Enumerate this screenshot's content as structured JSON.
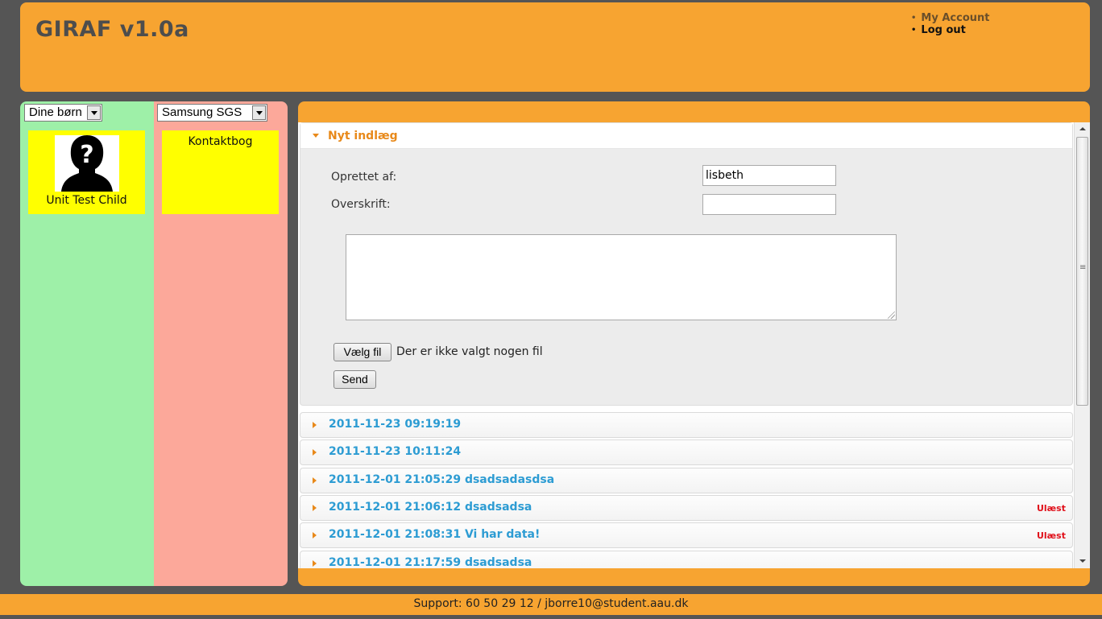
{
  "header": {
    "title": "GIRAF v1.0a",
    "menu": {
      "my_account": "My Account",
      "log_out": "Log out"
    }
  },
  "left": {
    "children_select": "Dine børn",
    "child": {
      "name": "Unit Test Child",
      "avatar_icon": "unknown-person-icon"
    }
  },
  "middle": {
    "device_select": "Samsung SGS",
    "app": {
      "name": "Kontaktbog"
    }
  },
  "form": {
    "section_title": "Nyt indlæg",
    "created_by_label": "Oprettet af:",
    "created_by_value": "lisbeth",
    "heading_label": "Overskrift:",
    "heading_value": "",
    "body_value": "",
    "choose_file_label": "Vælg fil",
    "no_file_text": "Der er ikke valgt nogen fil",
    "send_label": "Send"
  },
  "entries": [
    {
      "title": "2011-11-23 09:19:19",
      "badge": ""
    },
    {
      "title": "2011-11-23 10:11:24",
      "badge": ""
    },
    {
      "title": "2011-12-01 21:05:29 dsadsadasdsa",
      "badge": ""
    },
    {
      "title": "2011-12-01 21:06:12 dsadsadsa",
      "badge": "Ulæst"
    },
    {
      "title": "2011-12-01 21:08:31 Vi har data!",
      "badge": "Ulæst"
    },
    {
      "title": "2011-12-01 21:17:59 dsadsadsa",
      "badge": ""
    }
  ],
  "footer": {
    "support": "Support: 60 50 29 12 / jborre10@student.aau.dk"
  },
  "colors": {
    "orange": "#f7a431",
    "green_column": "#9ef0a8",
    "pink_column": "#fca89a",
    "card_yellow": "#ffff00",
    "link_blue": "#2d9cd3",
    "unread_red": "#e0101a"
  }
}
